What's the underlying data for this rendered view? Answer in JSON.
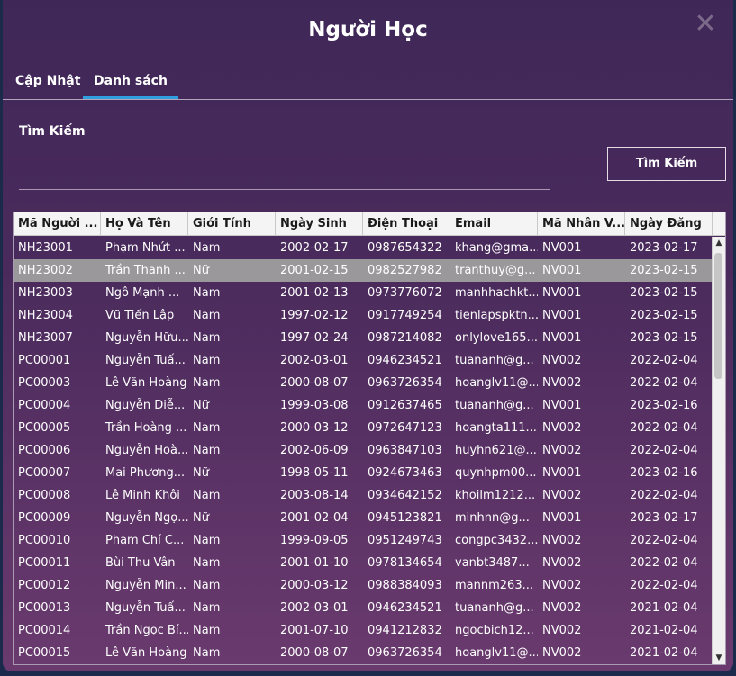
{
  "window": {
    "title": "Người Học",
    "close_glyph": "✕"
  },
  "tabs": [
    {
      "label": "Cập Nhật"
    },
    {
      "label": "Danh sách"
    }
  ],
  "search": {
    "label": "Tìm Kiếm",
    "placeholder": "",
    "value": "",
    "button_label": "Tìm Kiếm"
  },
  "table": {
    "columns": [
      "Mã Người ...",
      "Họ Và Tên",
      "Giới Tính",
      "Ngày Sinh",
      "Điện Thoại",
      "Email",
      "Mã Nhân V...",
      "Ngày Đăng"
    ],
    "rows": [
      [
        "NH23001",
        "Phạm Nhứt ...",
        "Nam",
        "2002-02-17",
        "0987654322",
        "khang@gma...",
        "NV001",
        "2023-02-17"
      ],
      [
        "NH23002",
        "Trần Thanh ...",
        "Nữ",
        "2001-02-15",
        "0982527982",
        "tranthuy@g...",
        "NV001",
        "2023-02-15"
      ],
      [
        "NH23003",
        "Ngô Mạnh ...",
        "Nam",
        "2001-02-13",
        "0973776072",
        "manhhachkt...",
        "NV001",
        "2023-02-15"
      ],
      [
        "NH23004",
        "Vũ Tiến  Lập",
        "Nam",
        "1997-02-12",
        "0917749254",
        "tienlapspktn...",
        "NV001",
        "2023-02-15"
      ],
      [
        "NH23007",
        "Nguyễn Hữu...",
        "Nam",
        "1997-02-24",
        "0987214082",
        "onlylove165...",
        "NV001",
        "2023-02-15"
      ],
      [
        "PC00001",
        "Nguyễn Tuấ...",
        "Nam",
        "2002-03-01",
        "0946234521",
        "tuananh@g...",
        "NV002",
        "2022-02-04"
      ],
      [
        "PC00003",
        "Lê Văn Hoàng",
        "Nam",
        "2000-08-07",
        "0963726354",
        "hoanglv11@...",
        "NV002",
        "2022-02-04"
      ],
      [
        "PC00004",
        "Nguyễn Diễ...",
        "Nữ",
        "1999-03-08",
        "0912637465",
        "tuananh@g...",
        "NV001",
        "2023-02-16"
      ],
      [
        "PC00005",
        "Trần Hoàng ...",
        "Nam",
        "2000-03-12",
        "0972647123",
        "hoangta111...",
        "NV002",
        "2022-02-04"
      ],
      [
        "PC00006",
        "Nguyễn Hoà...",
        "Nam",
        "2002-06-09",
        "0963847103",
        "huyhn621@...",
        "NV002",
        "2022-02-04"
      ],
      [
        "PC00007",
        "Mai Phương...",
        "Nữ",
        "1998-05-11",
        "0924673463",
        "quynhpm00...",
        "NV001",
        "2023-02-16"
      ],
      [
        "PC00008",
        "Lê Minh Khôi",
        "Nam",
        "2003-08-14",
        "0934642152",
        "khoilm1212...",
        "NV002",
        "2022-02-04"
      ],
      [
        "PC00009",
        "Nguyễn Ngọ...",
        "Nữ",
        "2001-02-04",
        "0945123821",
        "minhnn@g...",
        "NV001",
        "2023-02-17"
      ],
      [
        "PC00010",
        "Phạm Chí C...",
        "Nam",
        "1999-09-05",
        "0951249743",
        "congpc3432...",
        "NV002",
        "2022-02-04"
      ],
      [
        "PC00011",
        "Bùi Thu Vân",
        "Nam",
        "2001-01-10",
        "0978134654",
        "vanbt3487...",
        "NV002",
        "2022-02-04"
      ],
      [
        "PC00012",
        "Nguyễn Min...",
        "Nam",
        "2000-03-12",
        "0988384093",
        "mannm263...",
        "NV002",
        "2022-02-04"
      ],
      [
        "PC00013",
        "Nguyễn Tuấ...",
        "Nam",
        "2002-03-01",
        "0946234521",
        "tuananh@g...",
        "NV002",
        "2021-02-04"
      ],
      [
        "PC00014",
        "Trần Ngọc Bí...",
        "Nam",
        "2001-07-10",
        "0941212832",
        "ngocbich12...",
        "NV002",
        "2021-02-04"
      ],
      [
        "PC00015",
        "Lê Văn Hoàng",
        "Nam",
        "2000-08-07",
        "0963726354",
        "hoanglv11@...",
        "NV002",
        "2021-02-04"
      ]
    ]
  }
}
